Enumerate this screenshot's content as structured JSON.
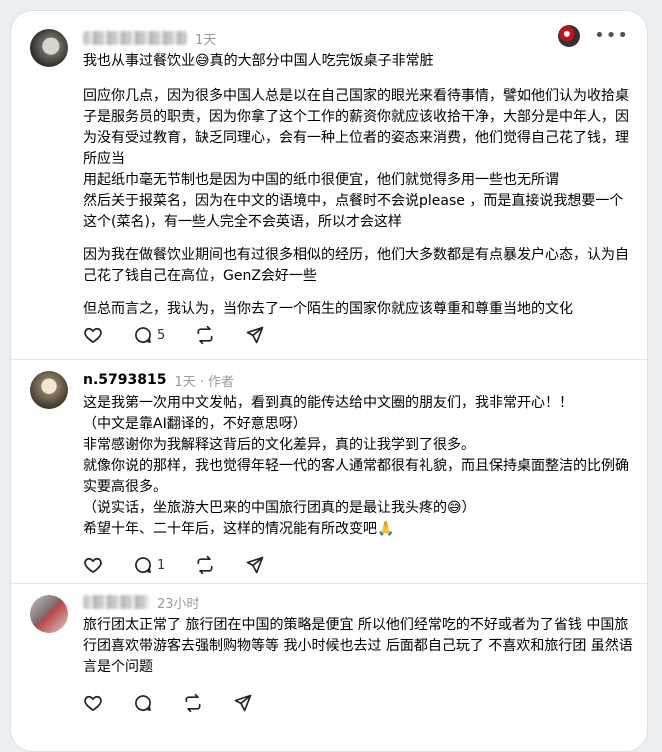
{
  "comments": [
    {
      "time": "1天",
      "author_suffix": "",
      "title_line": "我也从事过餐饮业😅真的大部分中国人吃完饭桌子非常脏",
      "paragraphs": [
        "回应你几点，因为很多中国人总是以在自己国家的眼光来看待事情，譬如他们认为收拾桌子是服务员的职责，因为你拿了这个工作的薪资你就应该收拾干净，大部分是中年人，因为没有受过教育，缺乏同理心，会有一种上位者的姿态来消费，他们觉得自己花了钱，理所应当\n用起纸巾毫无节制也是因为中国的纸巾很便宜，他们就觉得多用一些也无所谓\n然后关于报菜名，因为在中文的语境中，点餐时不会说please ，而是直接说我想要一个这个(菜名)，有一些人完全不会英语，所以才会这样",
        "因为我在做餐饮业期间也有过很多相似的经历，他们大多数都是有点暴发户心态，认为自己花了钱自己在高位，GenZ会好一些",
        "但总而言之，我认为，当你去了一个陌生的国家你就应该尊重和尊重当地的文化"
      ],
      "reply_count": "5"
    },
    {
      "username": "n.5793815",
      "time": "1天",
      "author_tag": "· 作者",
      "paragraphs": [
        "这是我第一次用中文发帖，看到真的能传达给中文圈的朋友们，我非常开心！！\n（中文是靠AI翻译的，不好意思呀）\n非常感谢你为我解释这背后的文化差异，真的让我学到了很多。\n就像你说的那样，我也觉得年轻一代的客人通常都很有礼貌，而且保持桌面整洁的比例确实要高很多。\n（说实话，坐旅游大巴来的中国旅行团真的是最让我头疼的😅）\n希望十年、二十年后，这样的情况能有所改变吧🙏"
      ],
      "reply_count": "1"
    },
    {
      "time": "23小时",
      "paragraphs": [
        "旅行团太正常了 旅行团在中国的策略是便宜 所以他们经常吃的不好或者为了省钱 中国旅行团喜欢带游客去强制购物等等 我小时候也去过 后面都自己玩了 不喜欢和旅行团 虽然语言是个问题"
      ],
      "reply_count": ""
    }
  ],
  "icons": [
    "heart-icon",
    "comment-icon",
    "repost-icon",
    "share-icon",
    "more-icon"
  ]
}
